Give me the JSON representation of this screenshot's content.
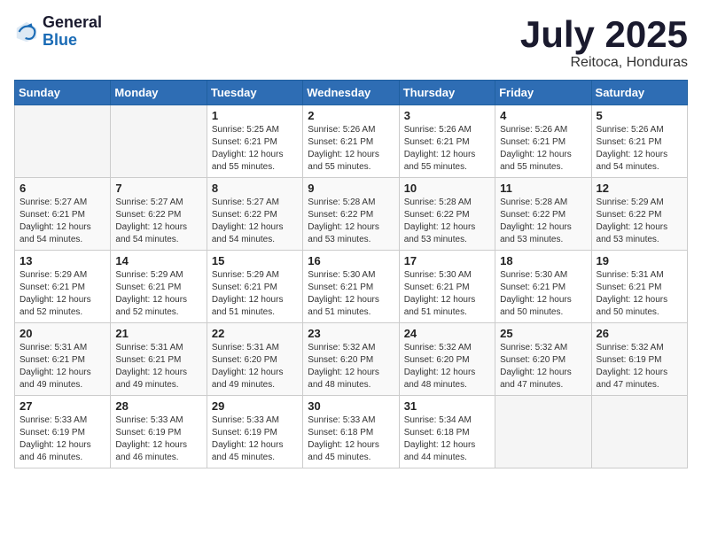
{
  "logo": {
    "general": "General",
    "blue": "Blue"
  },
  "header": {
    "month": "July 2025",
    "location": "Reitoca, Honduras"
  },
  "weekdays": [
    "Sunday",
    "Monday",
    "Tuesday",
    "Wednesday",
    "Thursday",
    "Friday",
    "Saturday"
  ],
  "weeks": [
    [
      {
        "day": "",
        "sunrise": "",
        "sunset": "",
        "daylight": ""
      },
      {
        "day": "",
        "sunrise": "",
        "sunset": "",
        "daylight": ""
      },
      {
        "day": "1",
        "sunrise": "Sunrise: 5:25 AM",
        "sunset": "Sunset: 6:21 PM",
        "daylight": "Daylight: 12 hours and 55 minutes."
      },
      {
        "day": "2",
        "sunrise": "Sunrise: 5:26 AM",
        "sunset": "Sunset: 6:21 PM",
        "daylight": "Daylight: 12 hours and 55 minutes."
      },
      {
        "day": "3",
        "sunrise": "Sunrise: 5:26 AM",
        "sunset": "Sunset: 6:21 PM",
        "daylight": "Daylight: 12 hours and 55 minutes."
      },
      {
        "day": "4",
        "sunrise": "Sunrise: 5:26 AM",
        "sunset": "Sunset: 6:21 PM",
        "daylight": "Daylight: 12 hours and 55 minutes."
      },
      {
        "day": "5",
        "sunrise": "Sunrise: 5:26 AM",
        "sunset": "Sunset: 6:21 PM",
        "daylight": "Daylight: 12 hours and 54 minutes."
      }
    ],
    [
      {
        "day": "6",
        "sunrise": "Sunrise: 5:27 AM",
        "sunset": "Sunset: 6:21 PM",
        "daylight": "Daylight: 12 hours and 54 minutes."
      },
      {
        "day": "7",
        "sunrise": "Sunrise: 5:27 AM",
        "sunset": "Sunset: 6:22 PM",
        "daylight": "Daylight: 12 hours and 54 minutes."
      },
      {
        "day": "8",
        "sunrise": "Sunrise: 5:27 AM",
        "sunset": "Sunset: 6:22 PM",
        "daylight": "Daylight: 12 hours and 54 minutes."
      },
      {
        "day": "9",
        "sunrise": "Sunrise: 5:28 AM",
        "sunset": "Sunset: 6:22 PM",
        "daylight": "Daylight: 12 hours and 53 minutes."
      },
      {
        "day": "10",
        "sunrise": "Sunrise: 5:28 AM",
        "sunset": "Sunset: 6:22 PM",
        "daylight": "Daylight: 12 hours and 53 minutes."
      },
      {
        "day": "11",
        "sunrise": "Sunrise: 5:28 AM",
        "sunset": "Sunset: 6:22 PM",
        "daylight": "Daylight: 12 hours and 53 minutes."
      },
      {
        "day": "12",
        "sunrise": "Sunrise: 5:29 AM",
        "sunset": "Sunset: 6:22 PM",
        "daylight": "Daylight: 12 hours and 53 minutes."
      }
    ],
    [
      {
        "day": "13",
        "sunrise": "Sunrise: 5:29 AM",
        "sunset": "Sunset: 6:21 PM",
        "daylight": "Daylight: 12 hours and 52 minutes."
      },
      {
        "day": "14",
        "sunrise": "Sunrise: 5:29 AM",
        "sunset": "Sunset: 6:21 PM",
        "daylight": "Daylight: 12 hours and 52 minutes."
      },
      {
        "day": "15",
        "sunrise": "Sunrise: 5:29 AM",
        "sunset": "Sunset: 6:21 PM",
        "daylight": "Daylight: 12 hours and 51 minutes."
      },
      {
        "day": "16",
        "sunrise": "Sunrise: 5:30 AM",
        "sunset": "Sunset: 6:21 PM",
        "daylight": "Daylight: 12 hours and 51 minutes."
      },
      {
        "day": "17",
        "sunrise": "Sunrise: 5:30 AM",
        "sunset": "Sunset: 6:21 PM",
        "daylight": "Daylight: 12 hours and 51 minutes."
      },
      {
        "day": "18",
        "sunrise": "Sunrise: 5:30 AM",
        "sunset": "Sunset: 6:21 PM",
        "daylight": "Daylight: 12 hours and 50 minutes."
      },
      {
        "day": "19",
        "sunrise": "Sunrise: 5:31 AM",
        "sunset": "Sunset: 6:21 PM",
        "daylight": "Daylight: 12 hours and 50 minutes."
      }
    ],
    [
      {
        "day": "20",
        "sunrise": "Sunrise: 5:31 AM",
        "sunset": "Sunset: 6:21 PM",
        "daylight": "Daylight: 12 hours and 49 minutes."
      },
      {
        "day": "21",
        "sunrise": "Sunrise: 5:31 AM",
        "sunset": "Sunset: 6:21 PM",
        "daylight": "Daylight: 12 hours and 49 minutes."
      },
      {
        "day": "22",
        "sunrise": "Sunrise: 5:31 AM",
        "sunset": "Sunset: 6:20 PM",
        "daylight": "Daylight: 12 hours and 49 minutes."
      },
      {
        "day": "23",
        "sunrise": "Sunrise: 5:32 AM",
        "sunset": "Sunset: 6:20 PM",
        "daylight": "Daylight: 12 hours and 48 minutes."
      },
      {
        "day": "24",
        "sunrise": "Sunrise: 5:32 AM",
        "sunset": "Sunset: 6:20 PM",
        "daylight": "Daylight: 12 hours and 48 minutes."
      },
      {
        "day": "25",
        "sunrise": "Sunrise: 5:32 AM",
        "sunset": "Sunset: 6:20 PM",
        "daylight": "Daylight: 12 hours and 47 minutes."
      },
      {
        "day": "26",
        "sunrise": "Sunrise: 5:32 AM",
        "sunset": "Sunset: 6:19 PM",
        "daylight": "Daylight: 12 hours and 47 minutes."
      }
    ],
    [
      {
        "day": "27",
        "sunrise": "Sunrise: 5:33 AM",
        "sunset": "Sunset: 6:19 PM",
        "daylight": "Daylight: 12 hours and 46 minutes."
      },
      {
        "day": "28",
        "sunrise": "Sunrise: 5:33 AM",
        "sunset": "Sunset: 6:19 PM",
        "daylight": "Daylight: 12 hours and 46 minutes."
      },
      {
        "day": "29",
        "sunrise": "Sunrise: 5:33 AM",
        "sunset": "Sunset: 6:19 PM",
        "daylight": "Daylight: 12 hours and 45 minutes."
      },
      {
        "day": "30",
        "sunrise": "Sunrise: 5:33 AM",
        "sunset": "Sunset: 6:18 PM",
        "daylight": "Daylight: 12 hours and 45 minutes."
      },
      {
        "day": "31",
        "sunrise": "Sunrise: 5:34 AM",
        "sunset": "Sunset: 6:18 PM",
        "daylight": "Daylight: 12 hours and 44 minutes."
      },
      {
        "day": "",
        "sunrise": "",
        "sunset": "",
        "daylight": ""
      },
      {
        "day": "",
        "sunrise": "",
        "sunset": "",
        "daylight": ""
      }
    ]
  ]
}
